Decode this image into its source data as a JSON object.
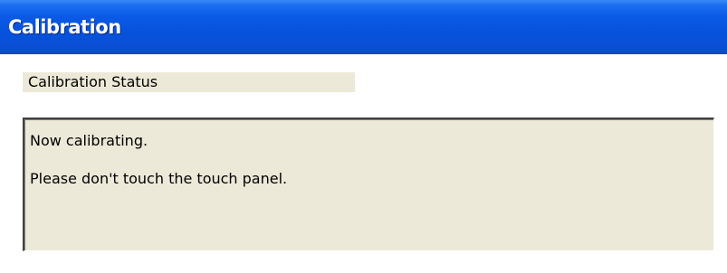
{
  "window": {
    "title": "Calibration"
  },
  "status": {
    "label": "Calibration Status"
  },
  "message": {
    "line1": "Now calibrating.",
    "line2": "Please don't touch the touch panel."
  },
  "colors": {
    "titlebar": "#0a5ae6",
    "panel_background": "#ece9d8"
  }
}
